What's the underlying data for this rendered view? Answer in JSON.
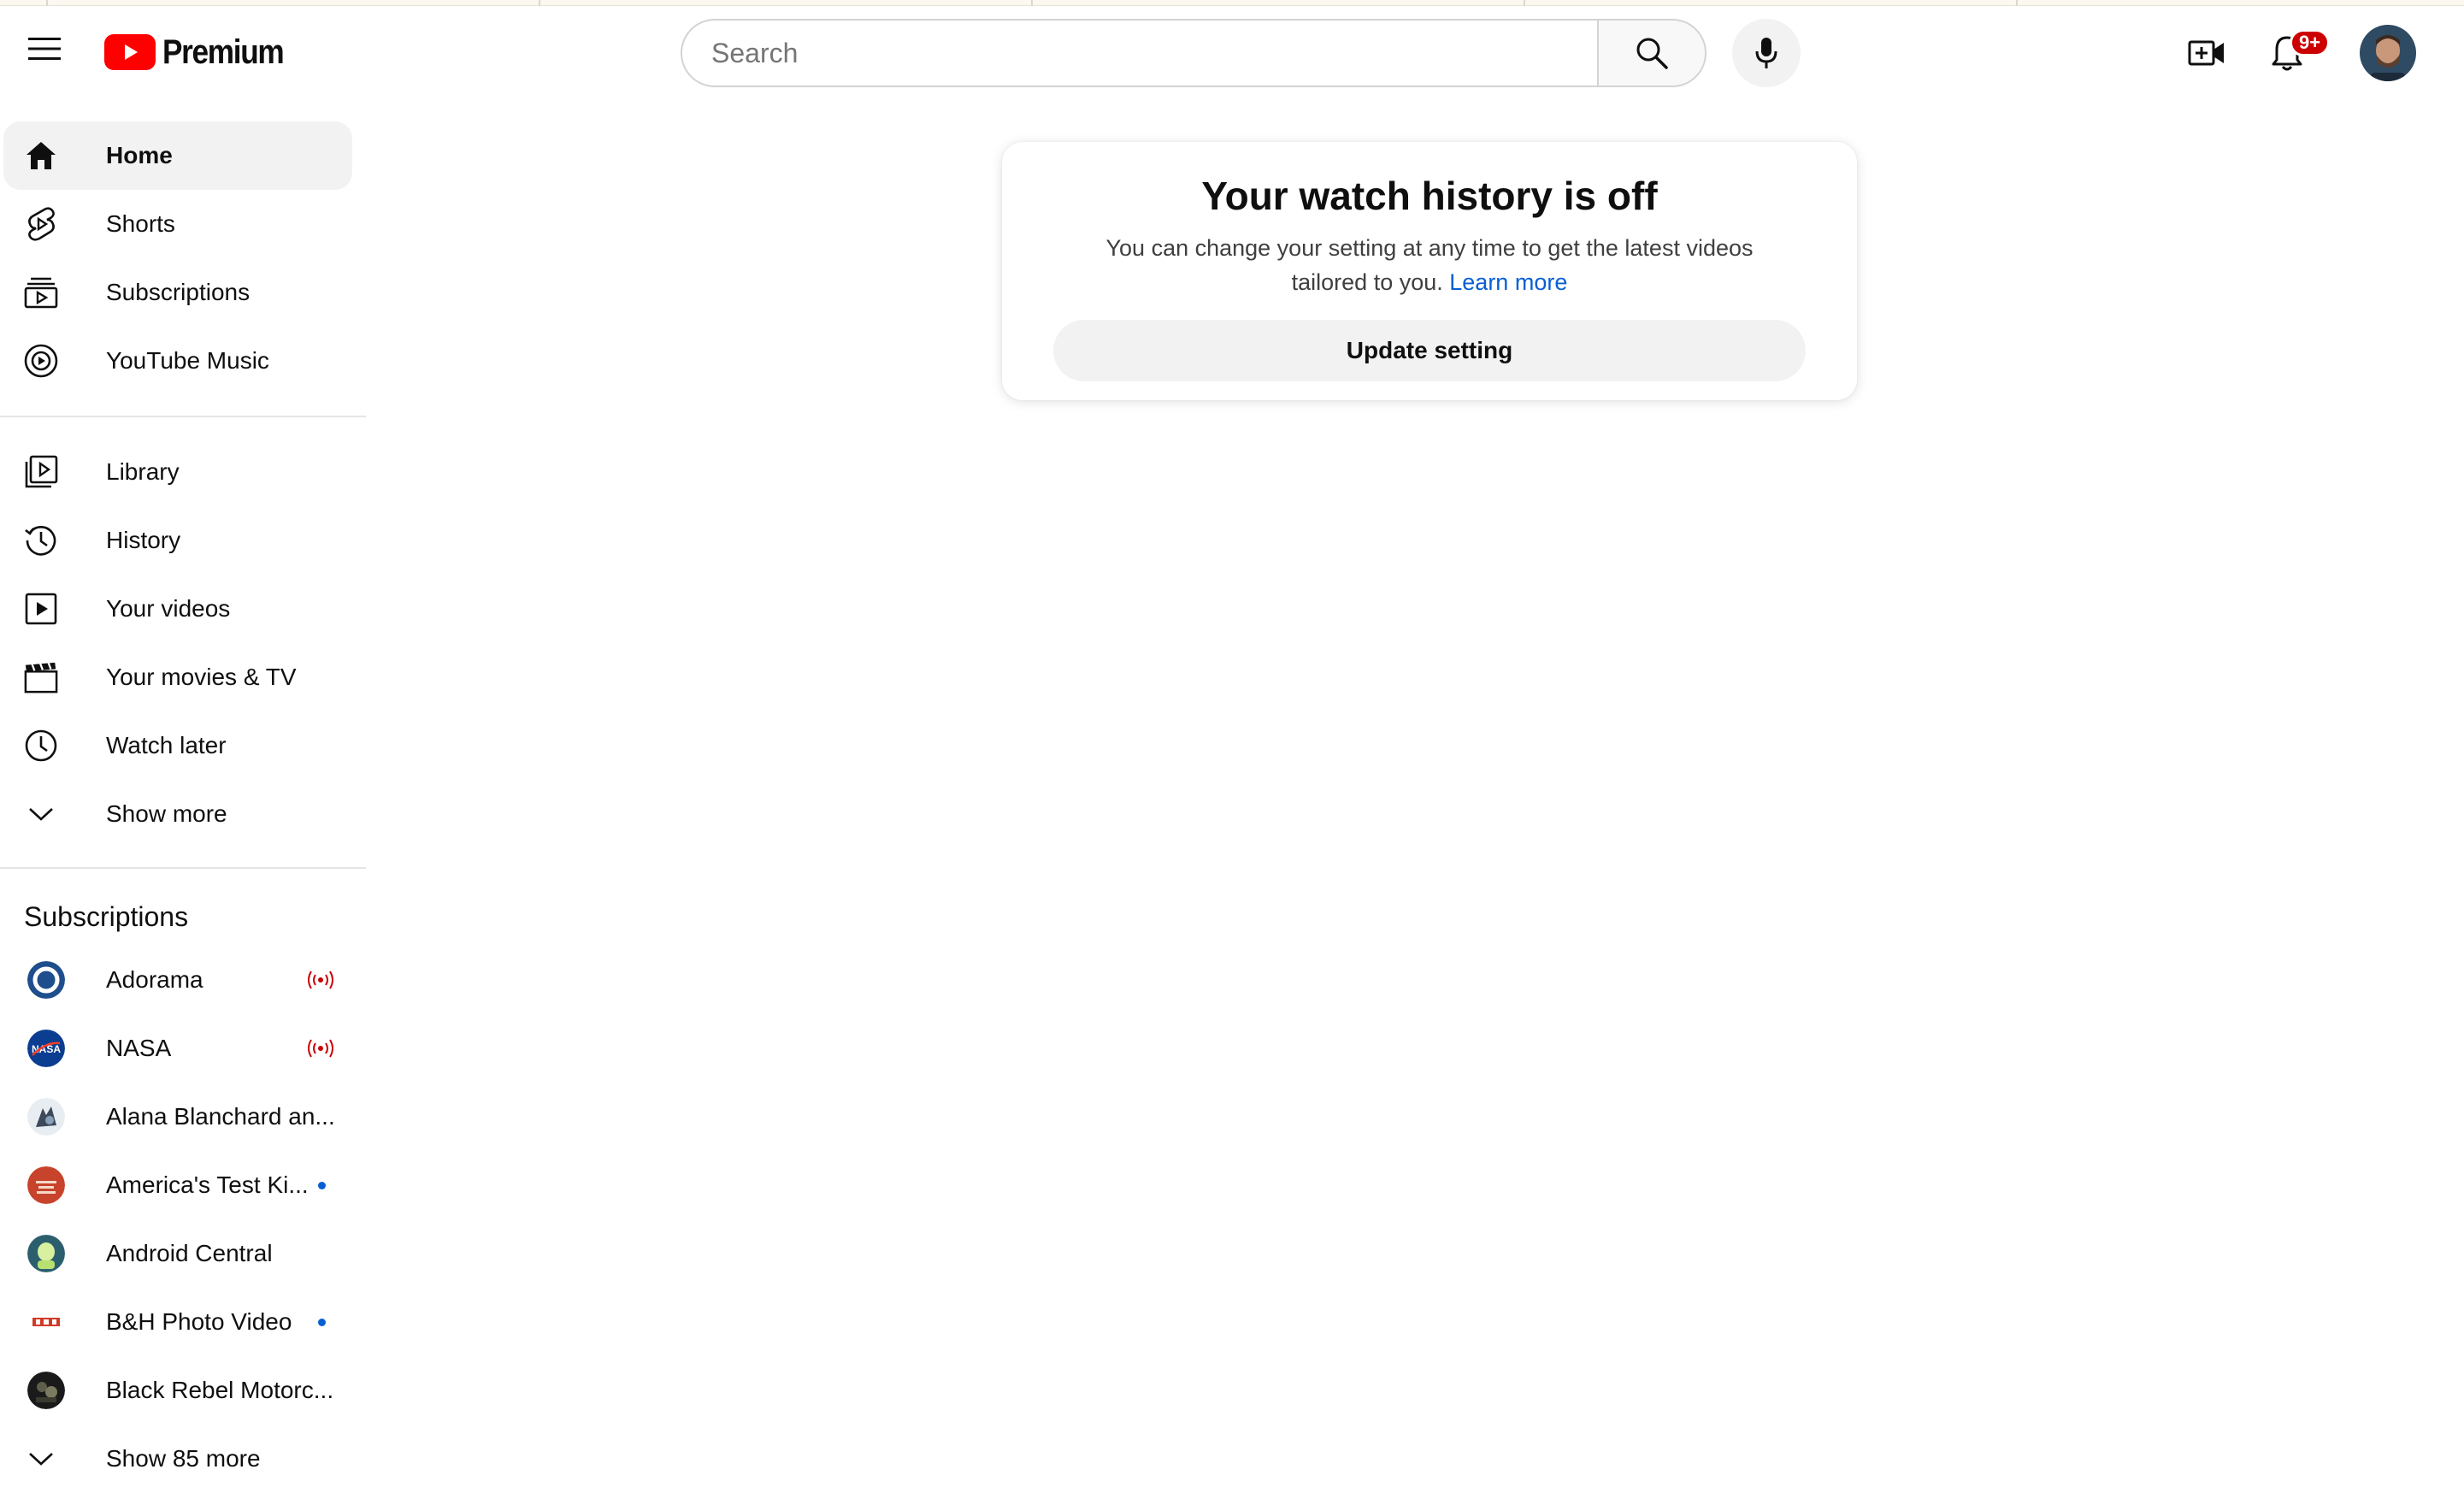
{
  "header": {
    "logo_text": "Premium",
    "search_placeholder": "Search",
    "notification_count": "9+"
  },
  "sidebar": {
    "primary": [
      {
        "label": "Home",
        "icon": "home-icon",
        "active": true
      },
      {
        "label": "Shorts",
        "icon": "shorts-icon"
      },
      {
        "label": "Subscriptions",
        "icon": "subscriptions-icon"
      },
      {
        "label": "YouTube Music",
        "icon": "music-icon"
      }
    ],
    "secondary": [
      {
        "label": "Library",
        "icon": "library-icon"
      },
      {
        "label": "History",
        "icon": "history-icon"
      },
      {
        "label": "Your videos",
        "icon": "your-videos-icon"
      },
      {
        "label": "Your movies & TV",
        "icon": "movies-icon"
      },
      {
        "label": "Watch later",
        "icon": "watch-later-icon"
      },
      {
        "label": "Show more",
        "icon": "chevron-down-icon"
      }
    ],
    "subscriptions_title": "Subscriptions",
    "subscriptions": [
      {
        "label": "Adorama",
        "indicator": "live"
      },
      {
        "label": "NASA",
        "indicator": "live"
      },
      {
        "label": "Alana Blanchard an...",
        "indicator": ""
      },
      {
        "label": "America's Test Ki...",
        "indicator": "new"
      },
      {
        "label": "Android Central",
        "indicator": ""
      },
      {
        "label": "B&H Photo Video",
        "indicator": "new"
      },
      {
        "label": "Black Rebel Motorc...",
        "indicator": ""
      }
    ],
    "show_more_subs": "Show 85 more"
  },
  "card": {
    "title": "Your watch history is off",
    "body": "You can change your setting at any time to get the latest videos tailored to you.",
    "link": "Learn more",
    "button": "Update setting"
  },
  "colors": {
    "brand_red": "#ff0000",
    "link_blue": "#065fd4",
    "active_bg": "#f2f2f2"
  }
}
